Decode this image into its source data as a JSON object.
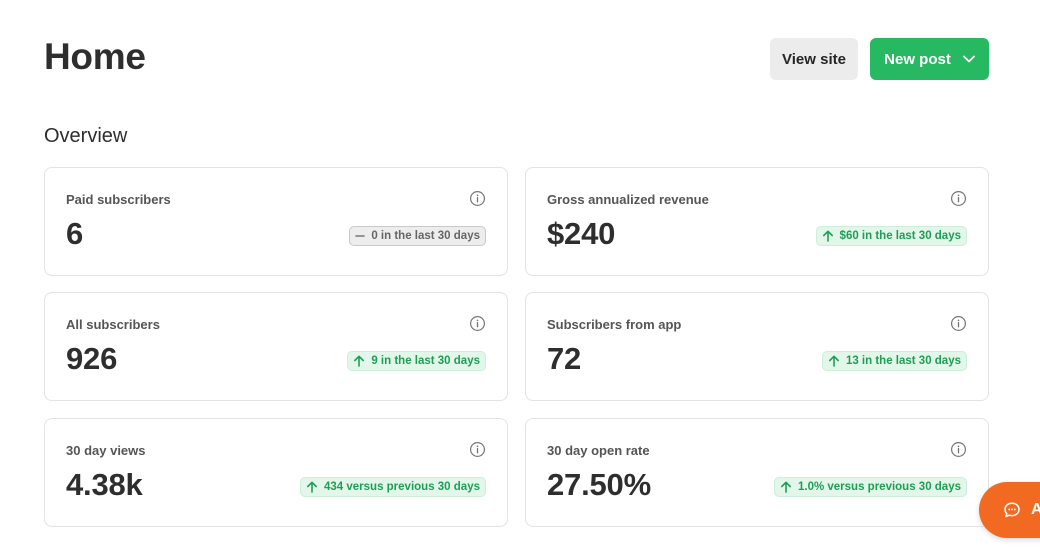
{
  "header": {
    "title": "Home",
    "view_site_label": "View site",
    "new_post_label": "New post"
  },
  "overview": {
    "title": "Overview",
    "cards": [
      {
        "label": "Paid subscribers",
        "value": "6",
        "change": "0 in the last 30 days",
        "trend": "flat"
      },
      {
        "label": "Gross annualized revenue",
        "value": "$240",
        "change": "$60 in the last 30 days",
        "trend": "up"
      },
      {
        "label": "All subscribers",
        "value": "926",
        "change": "9 in the last 30 days",
        "trend": "up"
      },
      {
        "label": "Subscribers from app",
        "value": "72",
        "change": "13 in the last 30 days",
        "trend": "up"
      },
      {
        "label": "30 day views",
        "value": "4.38k",
        "change": "434 versus previous 30 days",
        "trend": "up"
      },
      {
        "label": "30 day open rate",
        "value": "27.50%",
        "change": "1.0% versus previous 30 days",
        "trend": "up"
      }
    ]
  },
  "chat": {
    "label": "A"
  },
  "colors": {
    "primary_green": "#26b961",
    "trend_up": "#1e9e55",
    "chat_orange": "#f26a21"
  },
  "icons": {
    "info": "info-circle-icon",
    "trend_up": "arrow-up-icon",
    "trend_flat": "dash-icon",
    "dropdown": "chevron-down-icon",
    "chat": "chat-bubble-icon"
  }
}
